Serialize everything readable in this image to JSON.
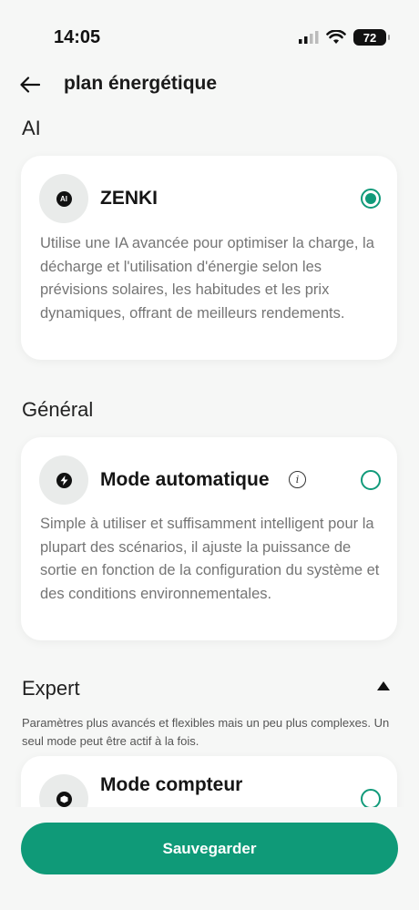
{
  "status_bar": {
    "time": "14:05",
    "battery": "72"
  },
  "header": {
    "title": "plan énergétique"
  },
  "sections": {
    "ai": {
      "title": "AI"
    },
    "general": {
      "title": "Général"
    },
    "expert": {
      "title": "Expert",
      "description": "Paramètres plus avancés et flexibles mais un peu plus complexes. Un seul mode peut être actif à la fois."
    }
  },
  "cards": {
    "zenki": {
      "icon_label": "AI",
      "title": "ZENKI",
      "description": "Utilise une IA avancée pour optimiser la charge, la décharge et l'utilisation d'énergie selon les prévisions solaires, les habitudes et les prix dynamiques, offrant de meilleurs rendements.",
      "selected": true
    },
    "auto": {
      "title": "Mode automatique",
      "description": "Simple à utiliser et suffisamment intelligent pour la plupart des scénarios, il ajuste la puissance de sortie en fonction de la configuration du système et des conditions environnementales.",
      "selected": false
    },
    "meter": {
      "title": "Mode compteur",
      "selected": false
    }
  },
  "footer": {
    "save_label": "Sauvegarder"
  },
  "colors": {
    "accent": "#0f9a78",
    "background": "#f6f7f6",
    "card": "#ffffff"
  }
}
